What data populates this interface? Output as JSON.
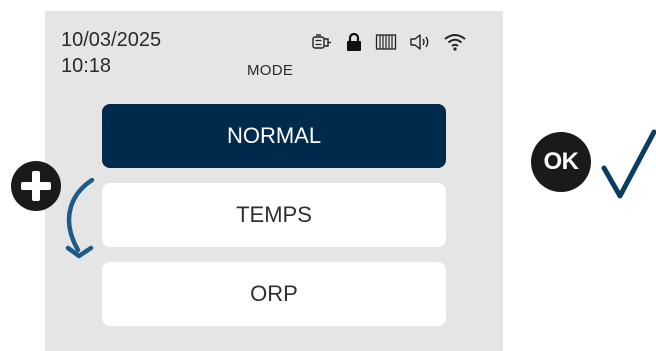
{
  "status": {
    "date": "10/03/2025",
    "time": "10:18",
    "icons": [
      "pump-icon",
      "lock-icon",
      "heater-icon",
      "speaker-icon",
      "wifi-icon"
    ]
  },
  "screen_title": "MODE",
  "menu": {
    "items": [
      {
        "label": "NORMAL",
        "selected": true
      },
      {
        "label": "TEMPS",
        "selected": false
      },
      {
        "label": "ORP",
        "selected": false
      }
    ]
  },
  "controls": {
    "ok_label": "OK",
    "plus_icon": "plus-icon",
    "arrow_icon": "curved-down-arrow-icon",
    "check_icon": "check-icon"
  },
  "colors": {
    "selected_bg": "#002a4b",
    "screen_bg": "#e5e5e5",
    "arrow": "#1d5a86",
    "check": "#0b3d63"
  }
}
